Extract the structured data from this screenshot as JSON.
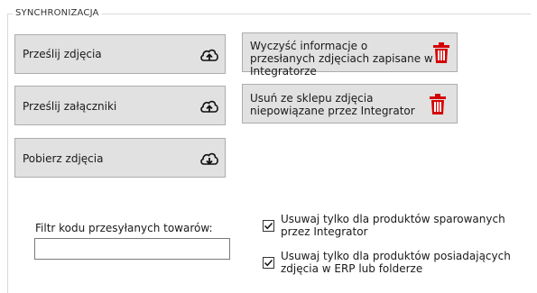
{
  "group": {
    "title": "SYNCHRONIZACJA"
  },
  "buttons": {
    "upload_photos": "Prześlij zdjęcia",
    "upload_attachments": "Prześlij załączniki",
    "download_photos": "Pobierz zdjęcia",
    "clear_info": "Wyczyść informacje o przesłanych zdjęciach zapisane w Integratorze",
    "remove_unlinked": "Usuń ze sklepu zdjęcia niepowiązane przez Integrator"
  },
  "filter": {
    "label": "Filtr kodu przesyłanych towarów:",
    "value": ""
  },
  "options": [
    {
      "label": "Usuwaj tylko dla produktów sparowanych przez Integrator",
      "checked": true
    },
    {
      "label": "Usuwaj tylko dla produktów posiadających zdjęcia w ERP lub folderze",
      "checked": true
    }
  ],
  "colors": {
    "trash": "#d40000",
    "button_bg": "#e1e1e1"
  }
}
